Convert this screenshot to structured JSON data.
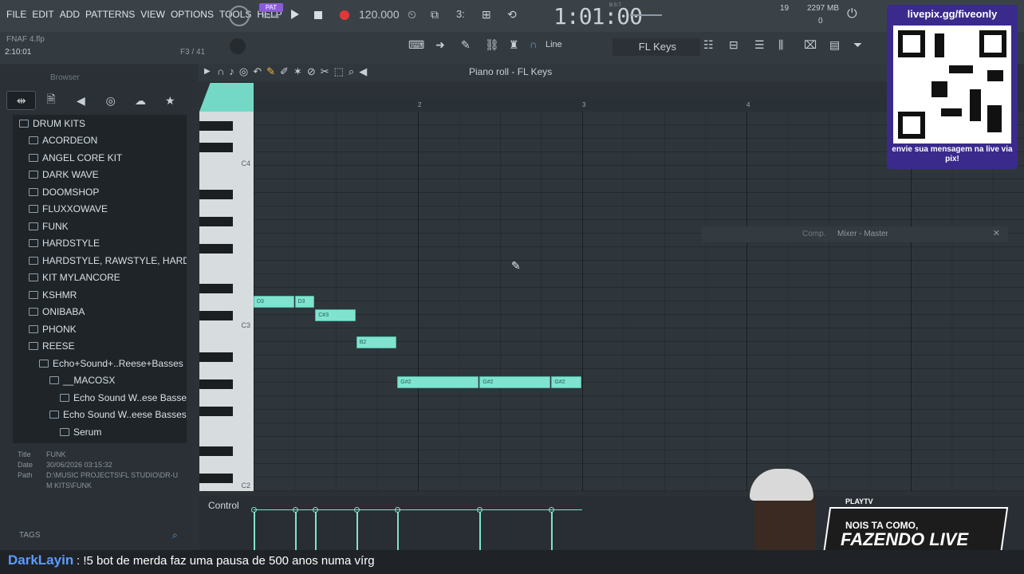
{
  "menu": {
    "items": [
      "FILE",
      "EDIT",
      "ADD",
      "PATTERNS",
      "VIEW",
      "OPTIONS",
      "TOOLS",
      "HELP"
    ]
  },
  "transport": {
    "pat_label": "PAT",
    "song_label": "SONG",
    "tempo": "120.000",
    "time": "1:01:00",
    "bst": "B:S:T",
    "cpu": "19",
    "mem": "2297 MB",
    "mem2": "0"
  },
  "project": {
    "filename": "FNAF 4.flp",
    "position": "2:10:01",
    "note_info": "F3 / 41"
  },
  "tools": {
    "snap": "Line",
    "channel": "FL Keys"
  },
  "browser": {
    "title": "Browser",
    "items": [
      {
        "label": "DRUM KITS",
        "level": 0
      },
      {
        "label": "ACORDEON",
        "level": 1
      },
      {
        "label": "ANGEL CORE KIT",
        "level": 1
      },
      {
        "label": "DARK WAVE",
        "level": 1
      },
      {
        "label": "DOOMSHOP",
        "level": 1
      },
      {
        "label": "FLUXXOWAVE",
        "level": 1
      },
      {
        "label": "FUNK",
        "level": 1
      },
      {
        "label": "HARDSTYLE",
        "level": 1
      },
      {
        "label": "HARDSTYLE, RAWSTYLE, HARDCORE",
        "level": 1
      },
      {
        "label": "KIT MYLANCORE",
        "level": 1
      },
      {
        "label": "KSHMR",
        "level": 1
      },
      {
        "label": "ONIBABA",
        "level": 1
      },
      {
        "label": "PHONK",
        "level": 1
      },
      {
        "label": "REESE",
        "level": 1
      },
      {
        "label": "Echo+Sound+..Reese+Basses",
        "level": 2
      },
      {
        "label": "__MACOSX",
        "level": 3
      },
      {
        "label": "Echo Sound W..ese Basses",
        "level": 4
      },
      {
        "label": "Echo Sound W..eese Basses",
        "level": 3
      },
      {
        "label": "Serum",
        "level": 4
      }
    ],
    "meta": {
      "title_label": "Title",
      "title_value": "FUNK",
      "date_label": "Date",
      "date_value": "30/06/2026 03:15:32",
      "path_label": "Path",
      "path_value": "D:\\MUSIC PROJECTS\\FL STUDIO\\DR-UM KITS\\FUNK"
    },
    "tags_label": "TAGS"
  },
  "piano_roll": {
    "title": "Piano roll - FL Keys",
    "bars": [
      "2",
      "3",
      "4"
    ],
    "key_labels": [
      "C4",
      "C3",
      "C2"
    ],
    "notes": [
      {
        "label": "D3",
        "start": 0.0,
        "len": 0.25,
        "row": "D3"
      },
      {
        "label": "D3",
        "start": 0.25,
        "len": 0.125,
        "row": "D3"
      },
      {
        "label": "C#3",
        "start": 0.375,
        "len": 0.25,
        "row": "C#3"
      },
      {
        "label": "B2",
        "start": 0.625,
        "len": 0.25,
        "row": "B2"
      },
      {
        "label": "G#2",
        "start": 0.875,
        "len": 0.5,
        "row": "G#2"
      },
      {
        "label": "G#2",
        "start": 1.375,
        "len": 0.4375,
        "row": "G#2"
      },
      {
        "label": "G#2",
        "start": 1.8125,
        "len": 0.1875,
        "row": "G#2"
      }
    ]
  },
  "control": {
    "label": "Control"
  },
  "mixer": {
    "label": "Mixer - Master",
    "comp": "Comp."
  },
  "overlay": {
    "qr_title": "livepix.gg/fiveonly",
    "qr_caption": "envie sua mensagem na live via pix!",
    "banner_line1": "NOIS TA COMO,",
    "banner_line2": "FAZENDO LIVE",
    "badge": "PLAYTV"
  },
  "chat": {
    "user": "DarkLayin",
    "message": ": !5 bot de merda faz uma pausa de 500 anos numa vírg"
  },
  "colors": {
    "note": "#7fe3cf",
    "accent": "#7fe3cf",
    "qr_bg": "#3a2a8c"
  }
}
